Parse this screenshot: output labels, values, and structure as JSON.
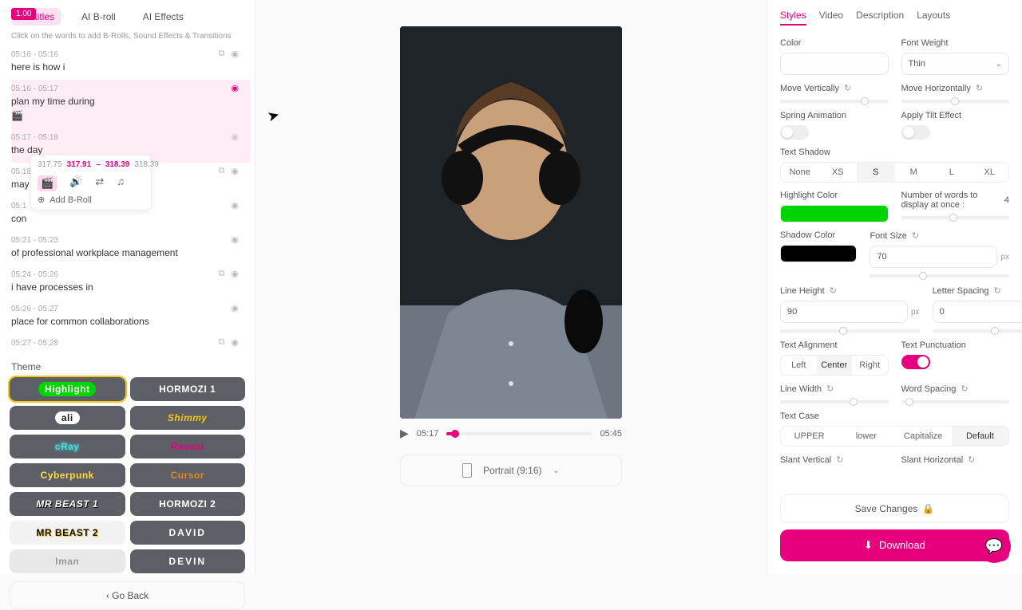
{
  "left": {
    "version_badge": "1.00",
    "tabs": {
      "subtitles": "Subtitles",
      "broll": "AI B-roll",
      "effects": "AI Effects"
    },
    "hint": "Click on the words to add B-Rolls, Sound Effects & Transitions",
    "rows": [
      {
        "time": "05:16 - 05:16",
        "text": "here is how i"
      },
      {
        "time": "05:16 - 05:17",
        "text": "plan my time during"
      },
      {
        "time": "05:17 - 05:18",
        "text": "the day"
      },
      {
        "time": "05:18",
        "text": "may"
      },
      {
        "time": "05:1",
        "text": "con"
      },
      {
        "time": "05:21 - 05:23",
        "text": "of professional workplace management"
      },
      {
        "time": "05:24 - 05:26",
        "text": "i have processes in"
      },
      {
        "time": "05:26 - 05:27",
        "text": "place for common collaborations"
      },
      {
        "time": "05:27 - 05:28",
        "text": ""
      }
    ],
    "popup": {
      "t1": "317.75",
      "r1": "317.91",
      "sep": "–",
      "r2": "318.39",
      "t2": "318.39",
      "add": "Add B-Roll"
    },
    "theme_label": "Theme",
    "themes": {
      "highlight": "Highlight",
      "hormozi1": "HORMOZI 1",
      "ali": "ali",
      "shimmy": "Shimmy",
      "cray": "cRay",
      "reveal": "Reveal",
      "cyber": "Cyberpunk",
      "cursor": "Cursor",
      "mb1": "MR BEAST 1",
      "horm2": "HORMOZI 2",
      "mb2": "MR BEAST 2",
      "david": "DAVID",
      "iman": "Iman",
      "devin": "DEVIN"
    },
    "go_back": "Go Back"
  },
  "center": {
    "cur_time": "05:17",
    "dur": "05:45",
    "aspect": "Portrait (9:16)"
  },
  "right": {
    "tabs": {
      "styles": "Styles",
      "video": "Video",
      "desc": "Description",
      "layouts": "Layouts"
    },
    "color_label": "Color",
    "fw_label": "Font Weight",
    "fw_val": "Thin",
    "mv_label": "Move Vertically",
    "mh_label": "Move Horizontally",
    "spring": "Spring Animation",
    "tilt": "Apply Tilt Effect",
    "shadow": "Text Shadow",
    "shadow_opts": {
      "none": "None",
      "xs": "XS",
      "s": "S",
      "m": "M",
      "l": "L",
      "xl": "XL"
    },
    "hcolor": "Highlight Color",
    "words_label": "Number of words to display at once :",
    "words_val": "4",
    "scolor": "Shadow Color",
    "fsize_label": "Font Size",
    "fsize_val": "70",
    "px": "px",
    "lheight_label": "Line Height",
    "lheight_val": "90",
    "lspace_label": "Letter Spacing",
    "lspace_val": "0",
    "talign": "Text Alignment",
    "align": {
      "l": "Left",
      "c": "Center",
      "r": "Right"
    },
    "tpunct": "Text Punctuation",
    "lwidth": "Line Width",
    "wspace": "Word Spacing",
    "tcase": "Text Case",
    "case": {
      "u": "UPPER",
      "l": "lower",
      "c": "Capitalize",
      "d": "Default"
    },
    "svert": "Slant Vertical",
    "shoriz": "Slant Horizontal",
    "save": "Save Changes",
    "dl": "Download"
  }
}
